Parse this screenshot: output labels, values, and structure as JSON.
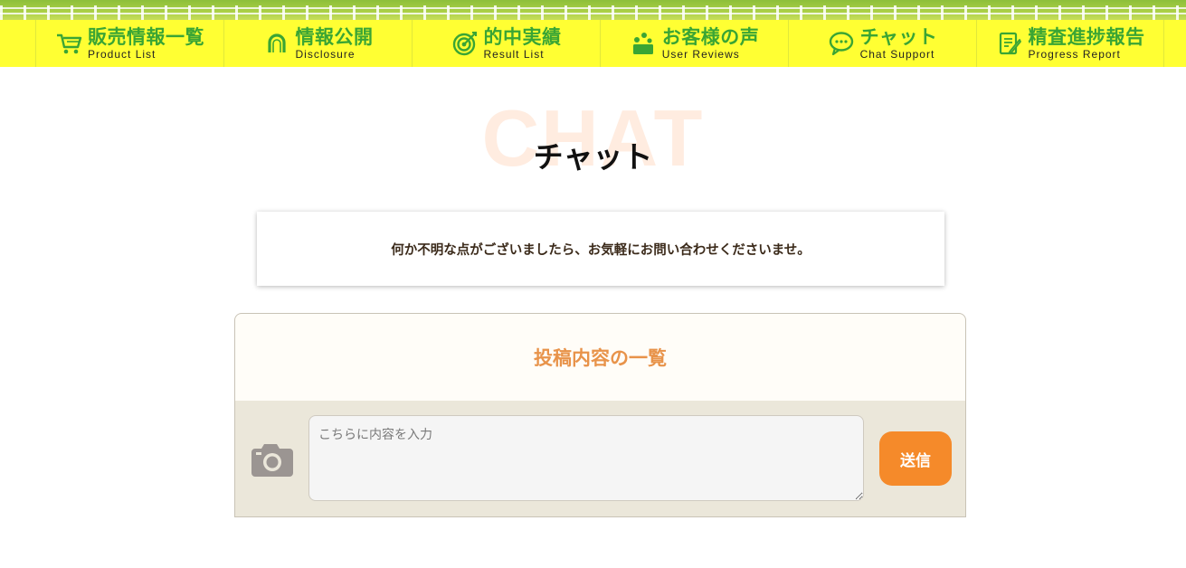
{
  "nav": {
    "items": [
      {
        "jp": "販売情報一覧",
        "en": "Product List",
        "icon": "cart-icon"
      },
      {
        "jp": "情報公開",
        "en": "Disclosure",
        "icon": "horseshoe-icon"
      },
      {
        "jp": "的中実績",
        "en": "Result List",
        "icon": "target-icon"
      },
      {
        "jp": "お客様の声",
        "en": "User Reviews",
        "icon": "people-icon"
      },
      {
        "jp": "チャット",
        "en": "Chat Support",
        "icon": "speech-bubble-icon"
      },
      {
        "jp": "精査進捗報告",
        "en": "Progress Report",
        "icon": "report-icon"
      }
    ]
  },
  "page": {
    "heading_bg": "CHAT",
    "heading": "チャット",
    "notice": "何か不明な点がございましたら、お気軽にお問い合わせくださいませ。"
  },
  "chat": {
    "title": "投稿内容の一覧",
    "input_placeholder": "こちらに内容を入力",
    "send_label": "送信"
  },
  "colors": {
    "nav_bg": "#ffff33",
    "nav_text": "#3aa534",
    "accent": "#f58a2a",
    "chat_title": "#e8934a"
  }
}
